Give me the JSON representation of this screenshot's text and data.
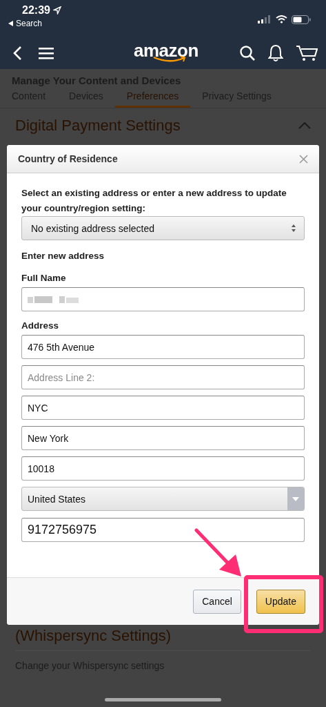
{
  "status_bar": {
    "time": "22:39",
    "back_label": "Search"
  },
  "nav": {
    "logo": "amazon"
  },
  "page": {
    "title": "Manage Your Content and Devices",
    "tabs": [
      {
        "label": "Content",
        "selected": false
      },
      {
        "label": "Devices",
        "selected": false
      },
      {
        "label": "Preferences",
        "selected": true
      },
      {
        "label": "Privacy Settings",
        "selected": false
      }
    ],
    "section_heading": "Digital Payment Settings",
    "lower_heading": "(Whispersync Settings)",
    "lower_link": "Change your Whispersync settings"
  },
  "dialog": {
    "title": "Country of Residence",
    "prompt": "Select an existing address or enter a new address to update your country/region setting:",
    "address_select": "No existing address selected",
    "subheading": "Enter new address",
    "fields": [
      {
        "kind": "redacted",
        "label": "Full Name"
      },
      {
        "kind": "text",
        "label": "Address",
        "value": "476 5th Avenue"
      },
      {
        "kind": "text",
        "placeholder": "Address Line 2:"
      },
      {
        "kind": "text",
        "value": "NYC"
      },
      {
        "kind": "text",
        "value": "New York"
      },
      {
        "kind": "text",
        "value": "10018"
      },
      {
        "kind": "select",
        "value": "United States"
      },
      {
        "kind": "phone",
        "value": "9172756975"
      }
    ],
    "buttons": [
      {
        "label": "Cancel",
        "primary": false
      },
      {
        "label": "Update",
        "primary": true
      }
    ]
  }
}
